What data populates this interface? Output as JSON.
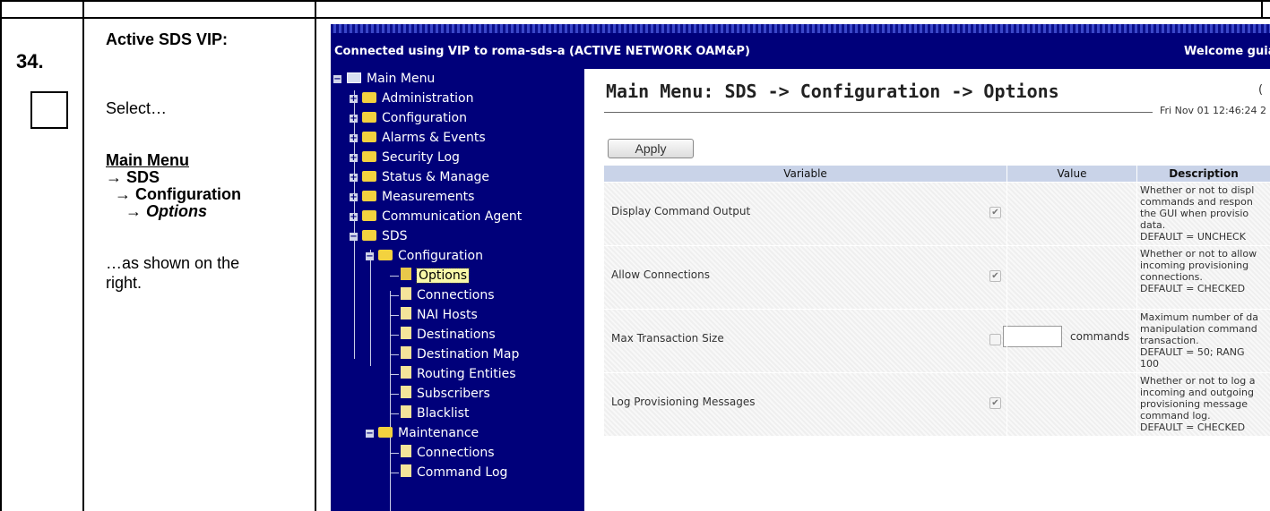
{
  "step": {
    "number": "34.",
    "title": "Active SDS VIP:",
    "select_text": "Select…",
    "path": [
      "Main Menu",
      "→ SDS",
      "→ Configuration",
      "→ Options"
    ],
    "as_shown": [
      "…as shown on the",
      "right."
    ]
  },
  "screenshot": {
    "banner_left": "Connected using VIP to roma-sds-a (ACTIVE NETWORK OAM&P)",
    "banner_right": "Welcome guiad",
    "nav": {
      "main_menu": "Main Menu",
      "items": [
        "Administration",
        "Configuration",
        "Alarms & Events",
        "Security Log",
        "Status & Manage",
        "Measurements",
        "Communication Agent",
        "SDS"
      ],
      "sds_children": {
        "configuration": "Configuration",
        "config_items": [
          "Options",
          "Connections",
          "NAI Hosts",
          "Destinations",
          "Destination Map",
          "Routing Entities",
          "Subscribers",
          "Blacklist"
        ],
        "maintenance": "Maintenance",
        "maint_items": [
          "Connections",
          "Command Log"
        ]
      }
    },
    "page_title": "Main Menu: SDS -> Configuration -> Options",
    "datetime": "Fri Nov 01 12:46:24 2",
    "corner": "(",
    "apply_label": "Apply",
    "table": {
      "headers": [
        "Variable",
        "Value",
        "Description"
      ],
      "rows": [
        {
          "variable": "Display Command Output",
          "checked": true,
          "desc": "Whether or not to displ\ncommands and respon\nthe GUI when provisio\ndata.\nDEFAULT = UNCHECK"
        },
        {
          "variable": "Allow Connections",
          "checked": true,
          "desc": "Whether or not to allow\nincoming provisioning\nconnections.\nDEFAULT = CHECKED"
        },
        {
          "variable": "Max Transaction Size",
          "checked": false,
          "input_value": "",
          "unit": "commands",
          "desc": "Maximum number of da\nmanipulation command\ntransaction.\nDEFAULT = 50; RANG\n100"
        },
        {
          "variable": "Log Provisioning Messages",
          "checked": true,
          "desc": "Whether or not to log a\nincoming and outgoing\nprovisioning message\ncommand log.\nDEFAULT = CHECKED"
        }
      ]
    }
  }
}
